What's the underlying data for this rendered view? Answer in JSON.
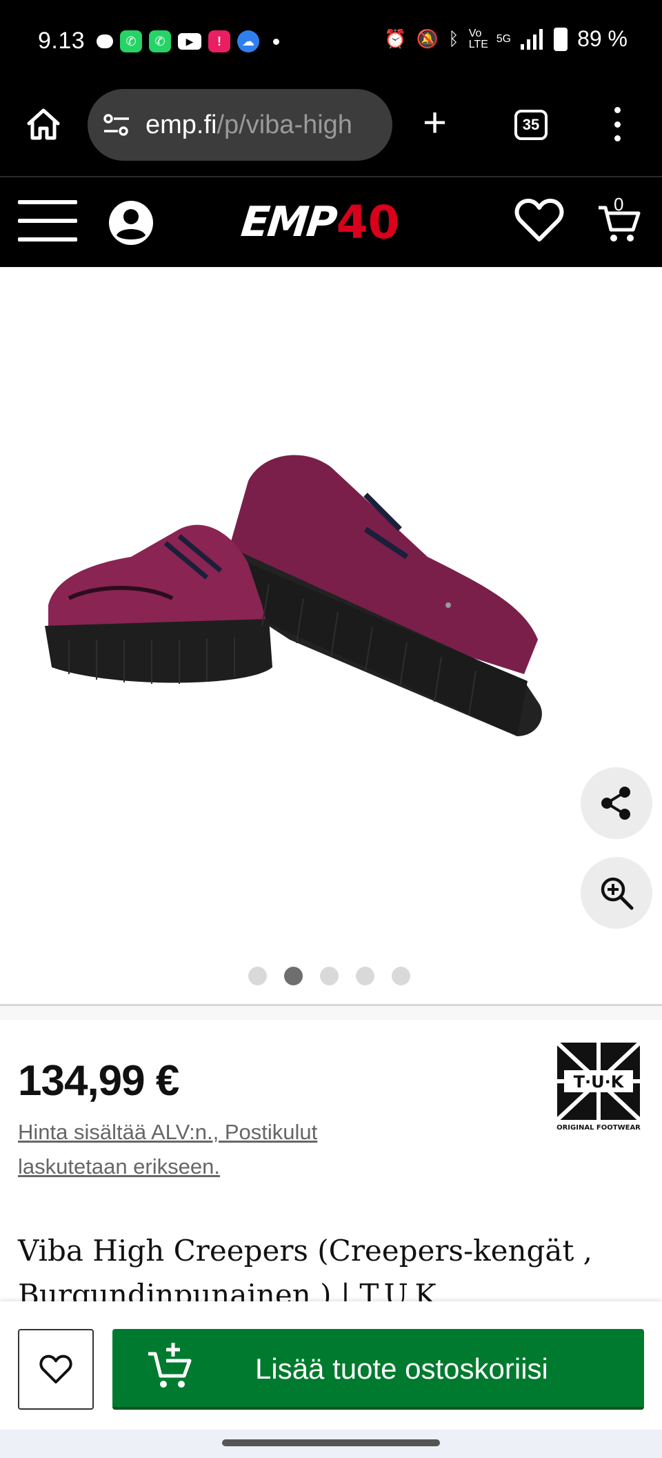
{
  "status_bar": {
    "time": "9.13",
    "battery": "89 %",
    "network": "5G",
    "volte": "Vo LTE"
  },
  "browser": {
    "url_domain": "emp.fi",
    "url_path": "/p/viba-high",
    "tab_count": "35"
  },
  "site_header": {
    "logo_text": "EMP",
    "logo_anniversary": "40",
    "cart_count": "0"
  },
  "gallery": {
    "image_alt": "Burgundy velvet creeper shoes with black platform soles",
    "slide_count": 5,
    "active_slide": 2
  },
  "product": {
    "price": "134,99 €",
    "vat_note": "Hinta sisältää ALV:n., Postikulut laskutetaan erikseen.",
    "brand_logo_text": "T·U·K",
    "brand_logo_subtext": "ORIGINAL FOOTWEAR",
    "title": "Viba High Creepers (Creepers-kengät , Burgundinpunainen ) | T.U.K."
  },
  "actions": {
    "add_to_cart_label": "Lisää tuote ostoskoriisi"
  },
  "colors": {
    "add_to_cart_green": "#007a2e",
    "brand_red": "#d9001b",
    "header_black": "#000000"
  }
}
